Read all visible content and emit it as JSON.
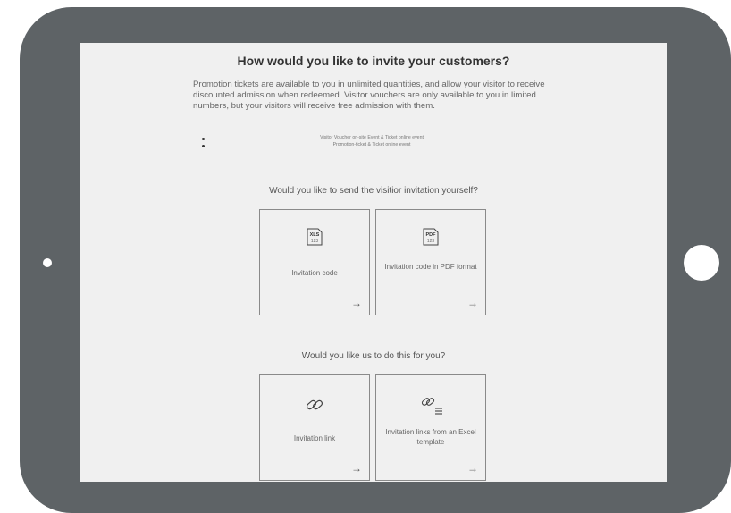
{
  "title": "How would you like to invite your customers?",
  "intro": "Promotion tickets are available to you in unlimited quantities, and allow your visitor to receive discounted admission when redeemed. Visitor vouchers are only available to you in limited numbers, but your visitors will receive free admission with them.",
  "bullets": [
    "Visitor Voucher on-site Event & Ticket online event",
    "Promotion-ticket & Ticket online event"
  ],
  "section1": {
    "question": "Would you like to send the visitior invitation yourself?",
    "cards": [
      {
        "label": "Invitation code",
        "icon": "xls-file-icon",
        "icon_top": "XLS",
        "icon_bottom": "123",
        "arrow": "→"
      },
      {
        "label": "Invitation code in PDF format",
        "icon": "pdf-file-icon",
        "icon_top": "PDF",
        "icon_bottom": "123",
        "arrow": "→"
      }
    ]
  },
  "section2": {
    "question": "Would you like us to do this for you?",
    "cards": [
      {
        "label": "Invitation link",
        "icon": "link-icon",
        "arrow": "→"
      },
      {
        "label": "Invitation links from an Excel template",
        "icon": "link-list-icon",
        "arrow": "→"
      }
    ]
  },
  "colors": {
    "device": "#5e6366",
    "screen": "#f0f0f0",
    "border": "#8a8a8a"
  }
}
